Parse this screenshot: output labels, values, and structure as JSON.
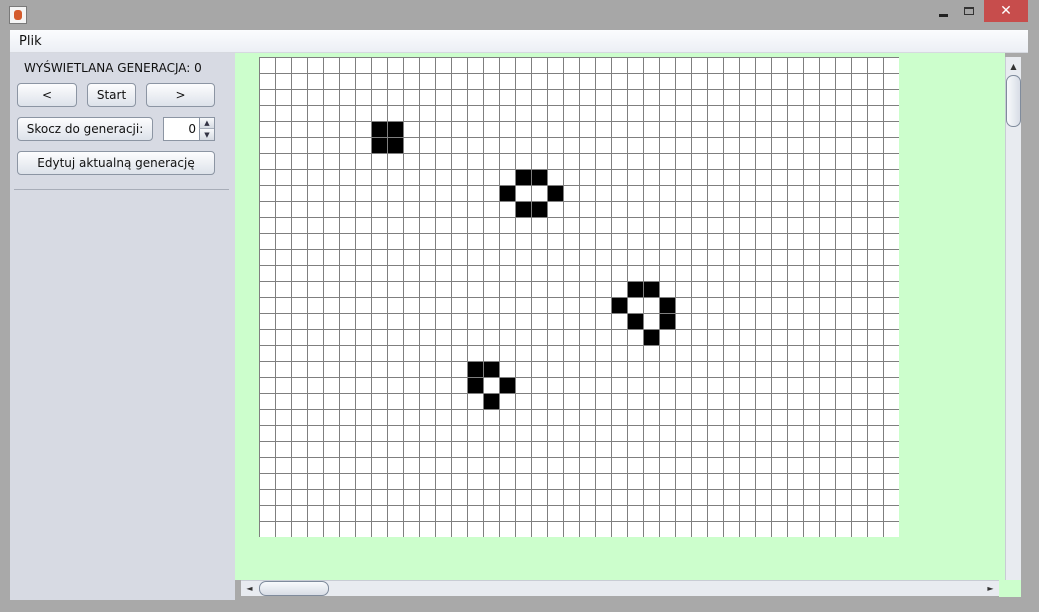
{
  "window": {
    "close_glyph": "✕",
    "icon": "java-icon"
  },
  "menu": {
    "file_label": "Plik"
  },
  "controls": {
    "generation_label": "WYŚWIETLANA GENERACJA: 0",
    "prev_label": "<",
    "start_label": "Start",
    "next_label": ">",
    "jump_label": "Skocz do generacji:",
    "jump_value": "0",
    "edit_label": "Edytuj aktualną generację"
  },
  "scrollbars": {
    "up_glyph": "▲",
    "down_glyph": "▼",
    "left_glyph": "◄",
    "right_glyph": "►"
  },
  "board": {
    "columns": 40,
    "rows": 30,
    "alive_cells": [
      [
        7,
        4
      ],
      [
        8,
        4
      ],
      [
        7,
        5
      ],
      [
        8,
        5
      ],
      [
        16,
        7
      ],
      [
        17,
        7
      ],
      [
        15,
        8
      ],
      [
        18,
        8
      ],
      [
        16,
        9
      ],
      [
        17,
        9
      ],
      [
        23,
        14
      ],
      [
        24,
        14
      ],
      [
        22,
        15
      ],
      [
        25,
        15
      ],
      [
        23,
        16
      ],
      [
        25,
        16
      ],
      [
        24,
        17
      ],
      [
        13,
        19
      ],
      [
        14,
        19
      ],
      [
        13,
        20
      ],
      [
        15,
        20
      ],
      [
        14,
        21
      ]
    ],
    "cell_color": "#000000",
    "dead_color": "#ffffff",
    "grid_color": "#7f7f7f",
    "background_color": "#ccfecc"
  }
}
